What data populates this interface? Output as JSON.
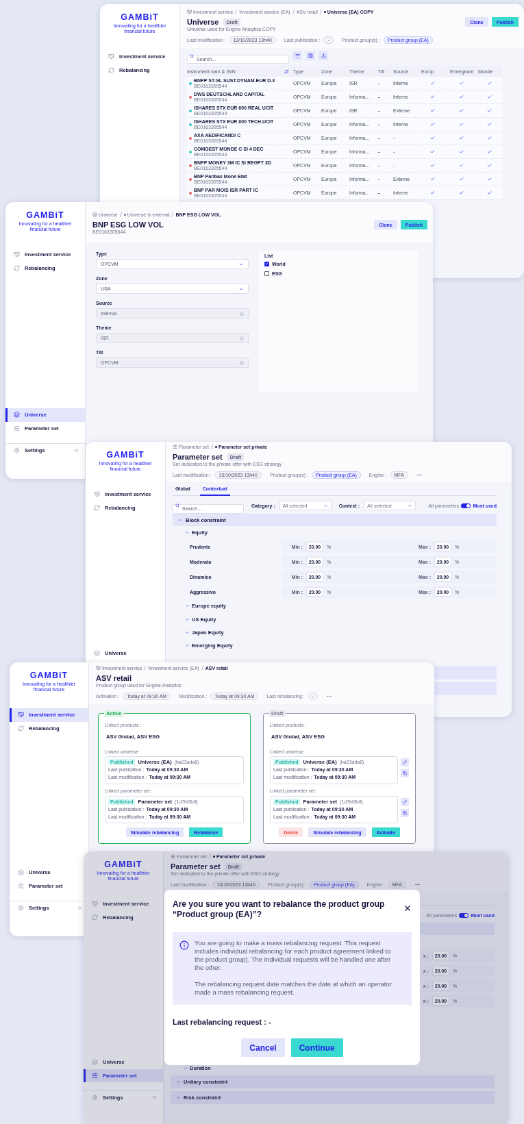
{
  "windows": [
    {
      "kind": "universe_list",
      "sidebar": {
        "logo": "GAMBiT",
        "tagline": "Innovating for a healthier financial future",
        "nav": [
          {
            "label": "Investment service",
            "selected": false
          },
          {
            "label": "Rebalancing",
            "selected": false
          }
        ]
      },
      "header": {
        "breadcrumb": [
          {
            "label": "Investment service",
            "kind": "root"
          },
          {
            "label": "Investment service (EA)",
            "kind": "plain"
          },
          {
            "label": "ASV retail",
            "kind": "plain"
          },
          {
            "label": "Universe (EA) COPY",
            "kind": "dot"
          }
        ],
        "title": "Universe",
        "badge": "Draft",
        "subtitle": "Universe used for Engine Analytics COPY",
        "meta": [
          {
            "label": "Last modification :",
            "value": "13/10/2023 13h40",
            "kind": "date"
          },
          {
            "label": "Last publication :",
            "value": "-",
            "kind": "date"
          },
          {
            "label": "Product group(s) :",
            "value": "Product group (EA)",
            "kind": "link"
          }
        ],
        "actions": [
          {
            "label": "Clone",
            "kind": "secondary"
          },
          {
            "label": "Publish",
            "kind": "primary"
          }
        ]
      },
      "search": {
        "placeholder": "Search..."
      },
      "table": {
        "name_column": "Instrument nam & ISIN",
        "columns": [
          "Type",
          "Zone",
          "Theme",
          "Tilt",
          "Source"
        ],
        "check_columns": [
          "Europ",
          "Emergeant",
          "Monde"
        ],
        "rows": [
          {
            "name": "BNPP ST.GL.SUST.DYNAM.EUR D.3",
            "isin": "BE0163305544",
            "color": "#2ec7bf",
            "cells": [
              "OPCVM",
              "Europe",
              "ISR",
              "-",
              "Interne"
            ],
            "checks": [
              true,
              true,
              true
            ]
          },
          {
            "name": "DWS DEUTSCHLAND CAPITAL",
            "isin": "BE0163305544",
            "color": "#f0615c",
            "cells": [
              "OPCVM",
              "Europe",
              "Informa...",
              "-",
              "Interne"
            ],
            "checks": [
              true,
              true,
              true
            ]
          },
          {
            "name": "ISHARES STX EUR 600 REAL UCIT",
            "isin": "BE0163305544",
            "color": "#2ec7bf",
            "cells": [
              "OPCVM",
              "Europe",
              "ISR",
              "-",
              "Externe"
            ],
            "checks": [
              true,
              true,
              true
            ]
          },
          {
            "name": "ISHARES STX EUR 600 TECH.UCIT",
            "isin": "BE0163305544",
            "color": "#2ec7bf",
            "cells": [
              "OPCVM",
              "Europe",
              "Informa...",
              "-",
              "Interne"
            ],
            "checks": [
              true,
              true,
              true
            ]
          },
          {
            "name": "AXA AEDIFICANDI C",
            "isin": "BE0163305544",
            "color": "#f0615c",
            "cells": [
              "OPCVM",
              "Europe",
              "Informa...",
              "-",
              "-"
            ],
            "checks": [
              true,
              true,
              true
            ]
          },
          {
            "name": "COMGEST MONDE C SI 4 DEC",
            "isin": "BE0163305544",
            "color": "#2ec7bf",
            "cells": [
              "OPCVM",
              "Europe",
              "Informa...",
              "-",
              "-"
            ],
            "checks": [
              true,
              true,
              true
            ]
          },
          {
            "name": "BNPP MONEY 3M IC SI REGPT 3D",
            "isin": "BE0163305544",
            "color": "#f0615c",
            "cells": [
              "OPCVM",
              "Europe",
              "Informa...",
              "-",
              "-"
            ],
            "checks": [
              true,
              true,
              true
            ]
          },
          {
            "name": "BNP Paribas Moné Etat",
            "isin": "BE0163305544",
            "color": "#f0615c",
            "cells": [
              "OPCVM",
              "Europe",
              "Informa...",
              "-",
              "Externe"
            ],
            "checks": [
              true,
              true,
              true
            ]
          },
          {
            "name": "BNP PAR MOIS ISR PART IC",
            "isin": "BE0163305544",
            "color": "#f0615c",
            "cells": [
              "OPCVM",
              "Europe",
              "Informa...",
              "-",
              "Interne"
            ],
            "checks": [
              true,
              true,
              true
            ]
          }
        ]
      }
    },
    {
      "kind": "instrument",
      "sidebar": {
        "logo": "GAMBiT",
        "tagline": "Innovating for a healthier financial future",
        "nav": [
          {
            "label": "Investment service",
            "selected": false
          },
          {
            "label": "Rebalancing",
            "selected": false
          }
        ],
        "bottom_nav": [
          {
            "label": "Universe",
            "selected": true
          },
          {
            "label": "Parameter set",
            "selected": false
          }
        ],
        "settings": "Settings"
      },
      "header": {
        "breadcrumb": [
          {
            "label": "Universe",
            "kind": "root"
          },
          {
            "label": "Universe Is external",
            "kind": "dot"
          },
          {
            "label": "BNP ESG LOW VOL",
            "kind": "plain"
          }
        ],
        "title": "BNP ESG LOW VOL",
        "subtitle": "BE0163305544",
        "actions": [
          {
            "label": "Clone",
            "kind": "secondary"
          },
          {
            "label": "Publish",
            "kind": "primary"
          }
        ]
      },
      "form": [
        {
          "label": "Type",
          "kind": "select",
          "value": "OPCVM"
        },
        {
          "label": "Zone",
          "kind": "select",
          "value": "USA"
        },
        {
          "label": "Source",
          "kind": "locked",
          "value": "Internal"
        },
        {
          "label": "Theme",
          "kind": "locked",
          "value": "ISR"
        },
        {
          "label": "Tilt",
          "kind": "locked",
          "value": "OPCVM"
        }
      ],
      "list": {
        "title": "List",
        "items": [
          {
            "label": "World",
            "checked": true
          },
          {
            "label": "ESG",
            "checked": false
          }
        ]
      }
    },
    {
      "kind": "parameter_set",
      "sidebar": {
        "logo": "GAMBiT",
        "tagline": "Innovating for a healthier financial future",
        "nav": [
          {
            "label": "Investment service",
            "selected": false
          },
          {
            "label": "Rebalancing",
            "selected": false
          }
        ],
        "bottom_nav": [
          {
            "label": "Universe",
            "selected": false
          }
        ]
      },
      "header": {
        "breadcrumb": [
          {
            "label": "Parameter set",
            "kind": "root"
          },
          {
            "label": "Parameter set private",
            "kind": "dot"
          }
        ],
        "title": "Parameter set",
        "badge": "Draft",
        "subtitle": "Set dedicated to the private offer with ESG strategy",
        "meta": [
          {
            "label": "Last modification :",
            "value": "13/10/2023 13h40",
            "kind": "date"
          },
          {
            "label": "Product group(s) :",
            "value": "Product group (EA)",
            "kind": "link"
          },
          {
            "label": "Engine :",
            "value": "MFA",
            "kind": "date"
          }
        ],
        "more_menu": true
      },
      "tabs": [
        {
          "label": "Global",
          "selected": false
        },
        {
          "label": "Contextual",
          "selected": true
        }
      ],
      "filters": {
        "search_placeholder": "Search...",
        "selects": [
          {
            "label": "Category :",
            "value": "All selected"
          },
          {
            "label": "Context :",
            "value": "All selected"
          }
        ],
        "toggle": {
          "off_label": "All parameters",
          "on_label": "Most used",
          "on": true
        }
      },
      "tree": [
        {
          "label": "Block constraint",
          "expanded": true,
          "children": [
            {
              "label": "Equity",
              "expanded": true,
              "rows": [
                {
                  "label": "Prudente",
                  "fields": [
                    {
                      "label": "Min :",
                      "value": "20.00",
                      "unit": "%"
                    },
                    {
                      "label": "Max :",
                      "value": "20.00",
                      "unit": "%"
                    }
                  ]
                },
                {
                  "label": "Moderato",
                  "fields": [
                    {
                      "label": "Min :",
                      "value": "20.00",
                      "unit": "%"
                    },
                    {
                      "label": "Max :",
                      "value": "20.00",
                      "unit": "%"
                    }
                  ]
                },
                {
                  "label": "Dinamico",
                  "fields": [
                    {
                      "label": "Min :",
                      "value": "20.00",
                      "unit": "%"
                    },
                    {
                      "label": "Max :",
                      "value": "20.00",
                      "unit": "%"
                    }
                  ]
                },
                {
                  "label": "Aggressivo",
                  "fields": [
                    {
                      "label": "Min :",
                      "value": "20.00",
                      "unit": "%"
                    },
                    {
                      "label": "Max :",
                      "value": "20.00",
                      "unit": "%"
                    }
                  ]
                }
              ]
            },
            {
              "label": "Europe equity",
              "expanded": false
            },
            {
              "label": "US Equity",
              "expanded": false
            },
            {
              "label": "Japan Equity",
              "expanded": false
            },
            {
              "label": "Emerging Equity",
              "expanded": false
            }
          ]
        }
      ]
    },
    {
      "kind": "product_group",
      "sidebar": {
        "logo": "GAMBiT",
        "tagline": "Innovating for a healthier financial future",
        "nav": [
          {
            "label": "Investment service",
            "selected": true
          },
          {
            "label": "Rebalancing",
            "selected": false
          }
        ],
        "bottom_nav": [
          {
            "label": "Universe",
            "selected": false
          },
          {
            "label": "Parameter set",
            "selected": false
          }
        ],
        "settings": "Settings"
      },
      "header": {
        "breadcrumb": [
          {
            "label": "Investment service",
            "kind": "root"
          },
          {
            "label": "Investment service (EA)",
            "kind": "plain"
          },
          {
            "label": "ASV retail",
            "kind": "plain"
          }
        ],
        "title": "ASV retail",
        "subtitle": "Product group used for Engine Analytics",
        "meta": [
          {
            "label": "Activation :",
            "value": "Today at 09:30 AM",
            "kind": "date"
          },
          {
            "label": "Modification :",
            "value": "Today at 09:30 AM",
            "kind": "date"
          },
          {
            "label": "Last rebalancing :",
            "value": "-",
            "kind": "date"
          }
        ],
        "more_menu": true
      },
      "cards": [
        {
          "status": "Active",
          "kind": "active",
          "products_label": "Linked products :",
          "products": "ASV Global, ASV ESG",
          "links": [
            {
              "label": "Linked universe :",
              "badge": "Published",
              "name": "Universe (EA)",
              "hash": "(ba23ada8)",
              "lines": [
                {
                  "label": "Last publication :",
                  "value": "Today at 09:30 AM"
                },
                {
                  "label": "Last modification :",
                  "value": "Today at 09:30 AM"
                }
              ],
              "editable": false
            },
            {
              "label": "Linked parameter set :",
              "badge": "Published",
              "name": "Parameter set",
              "hash": "(1d7b05df)",
              "lines": [
                {
                  "label": "Last publication :",
                  "value": "Today at 09:30 AM"
                },
                {
                  "label": "Last modification :",
                  "value": "Today at 09:30 AM"
                }
              ],
              "editable": false
            }
          ],
          "buttons": [
            {
              "label": "Simulate rebalancing",
              "kind": "secondary"
            },
            {
              "label": "Rebalance",
              "kind": "primary"
            }
          ]
        },
        {
          "status": "Draft",
          "kind": "draft",
          "products_label": "Linked products :",
          "products": "ASV Global, ASV ESG",
          "links": [
            {
              "label": "Linked universe :",
              "badge": "Published",
              "name": "Universe (EA)",
              "hash": "(ba23ada8)",
              "lines": [
                {
                  "label": "Last publication :",
                  "value": "Today at 09:30 AM"
                },
                {
                  "label": "Last modification :",
                  "value": "Today at 09:30 AM"
                }
              ],
              "editable": true
            },
            {
              "label": "Linked parameter set :",
              "badge": "Published",
              "name": "Parameter set",
              "hash": "(1d7b05df)",
              "lines": [
                {
                  "label": "Last publication :",
                  "value": "Today at 09:30 AM"
                },
                {
                  "label": "Last modification :",
                  "value": "Today at 09:30 AM"
                }
              ],
              "editable": true
            }
          ],
          "buttons": [
            {
              "label": "Delete",
              "kind": "danger"
            },
            {
              "label": "Simulate rebalancing",
              "kind": "secondary"
            },
            {
              "label": "Activate",
              "kind": "primary"
            }
          ]
        }
      ]
    },
    {
      "kind": "parameter_set_dialog",
      "sidebar": {
        "logo": "GAMBiT",
        "tagline": "Innovating for a healthier financial future",
        "nav": [
          {
            "label": "Investment service",
            "selected": false
          },
          {
            "label": "Rebalancing",
            "selected": false
          }
        ],
        "bottom_nav": [
          {
            "label": "Universe",
            "selected": false
          },
          {
            "label": "Parameter set",
            "selected": true
          }
        ],
        "settings": "Settings"
      },
      "header": {
        "breadcrumb": [
          {
            "label": "Parameter set",
            "kind": "root"
          },
          {
            "label": "Parameter set private",
            "kind": "dot"
          }
        ],
        "title": "Parameter set",
        "badge": "Draft",
        "subtitle": "Set dedicated to the private offer with ESG strategy",
        "meta": [
          {
            "label": "Last modification :",
            "value": "13/10/2023 13h40",
            "kind": "date"
          },
          {
            "label": "Product group(s) :",
            "value": "Product group (EA)",
            "kind": "link"
          },
          {
            "label": "Engine :",
            "value": "MFA",
            "kind": "date"
          }
        ],
        "more_menu": true
      },
      "toggle": {
        "off_label": "All parameters",
        "on_label": "Most used",
        "on": true
      },
      "rows": [
        {
          "fields": [
            {
              "label": "x :",
              "value": "20.00",
              "unit": "%"
            }
          ]
        },
        {
          "fields": [
            {
              "label": "x :",
              "value": "20.00",
              "unit": "%"
            }
          ]
        },
        {
          "fields": [
            {
              "label": "x :",
              "value": "20.00",
              "unit": "%"
            }
          ]
        },
        {
          "fields": [
            {
              "label": "x :",
              "value": "20.00",
              "unit": "%"
            }
          ]
        }
      ],
      "subsections": [
        {
          "label": "Duration",
          "expanded": false
        }
      ],
      "sections": [
        {
          "label": "Unitary constraint",
          "expanded": false
        },
        {
          "label": "Risk constraint",
          "expanded": false
        }
      ],
      "dialog": {
        "title": "Are you sure you want to rebalance the product group “Product group (EA)”?",
        "info": [
          "You are going to make a mass rebalancing request. This request includes individual rebalancing for each product agreement linked to the product group). The individual requests will be handled one after the other.",
          "The rebalancing request date matches the date at which an operator made a mass rebalancing request."
        ],
        "last_request": "Last rebalancing request : -",
        "buttons": [
          {
            "label": "Cancel",
            "kind": "secondary"
          },
          {
            "label": "Continue",
            "kind": "primary"
          }
        ]
      }
    }
  ]
}
